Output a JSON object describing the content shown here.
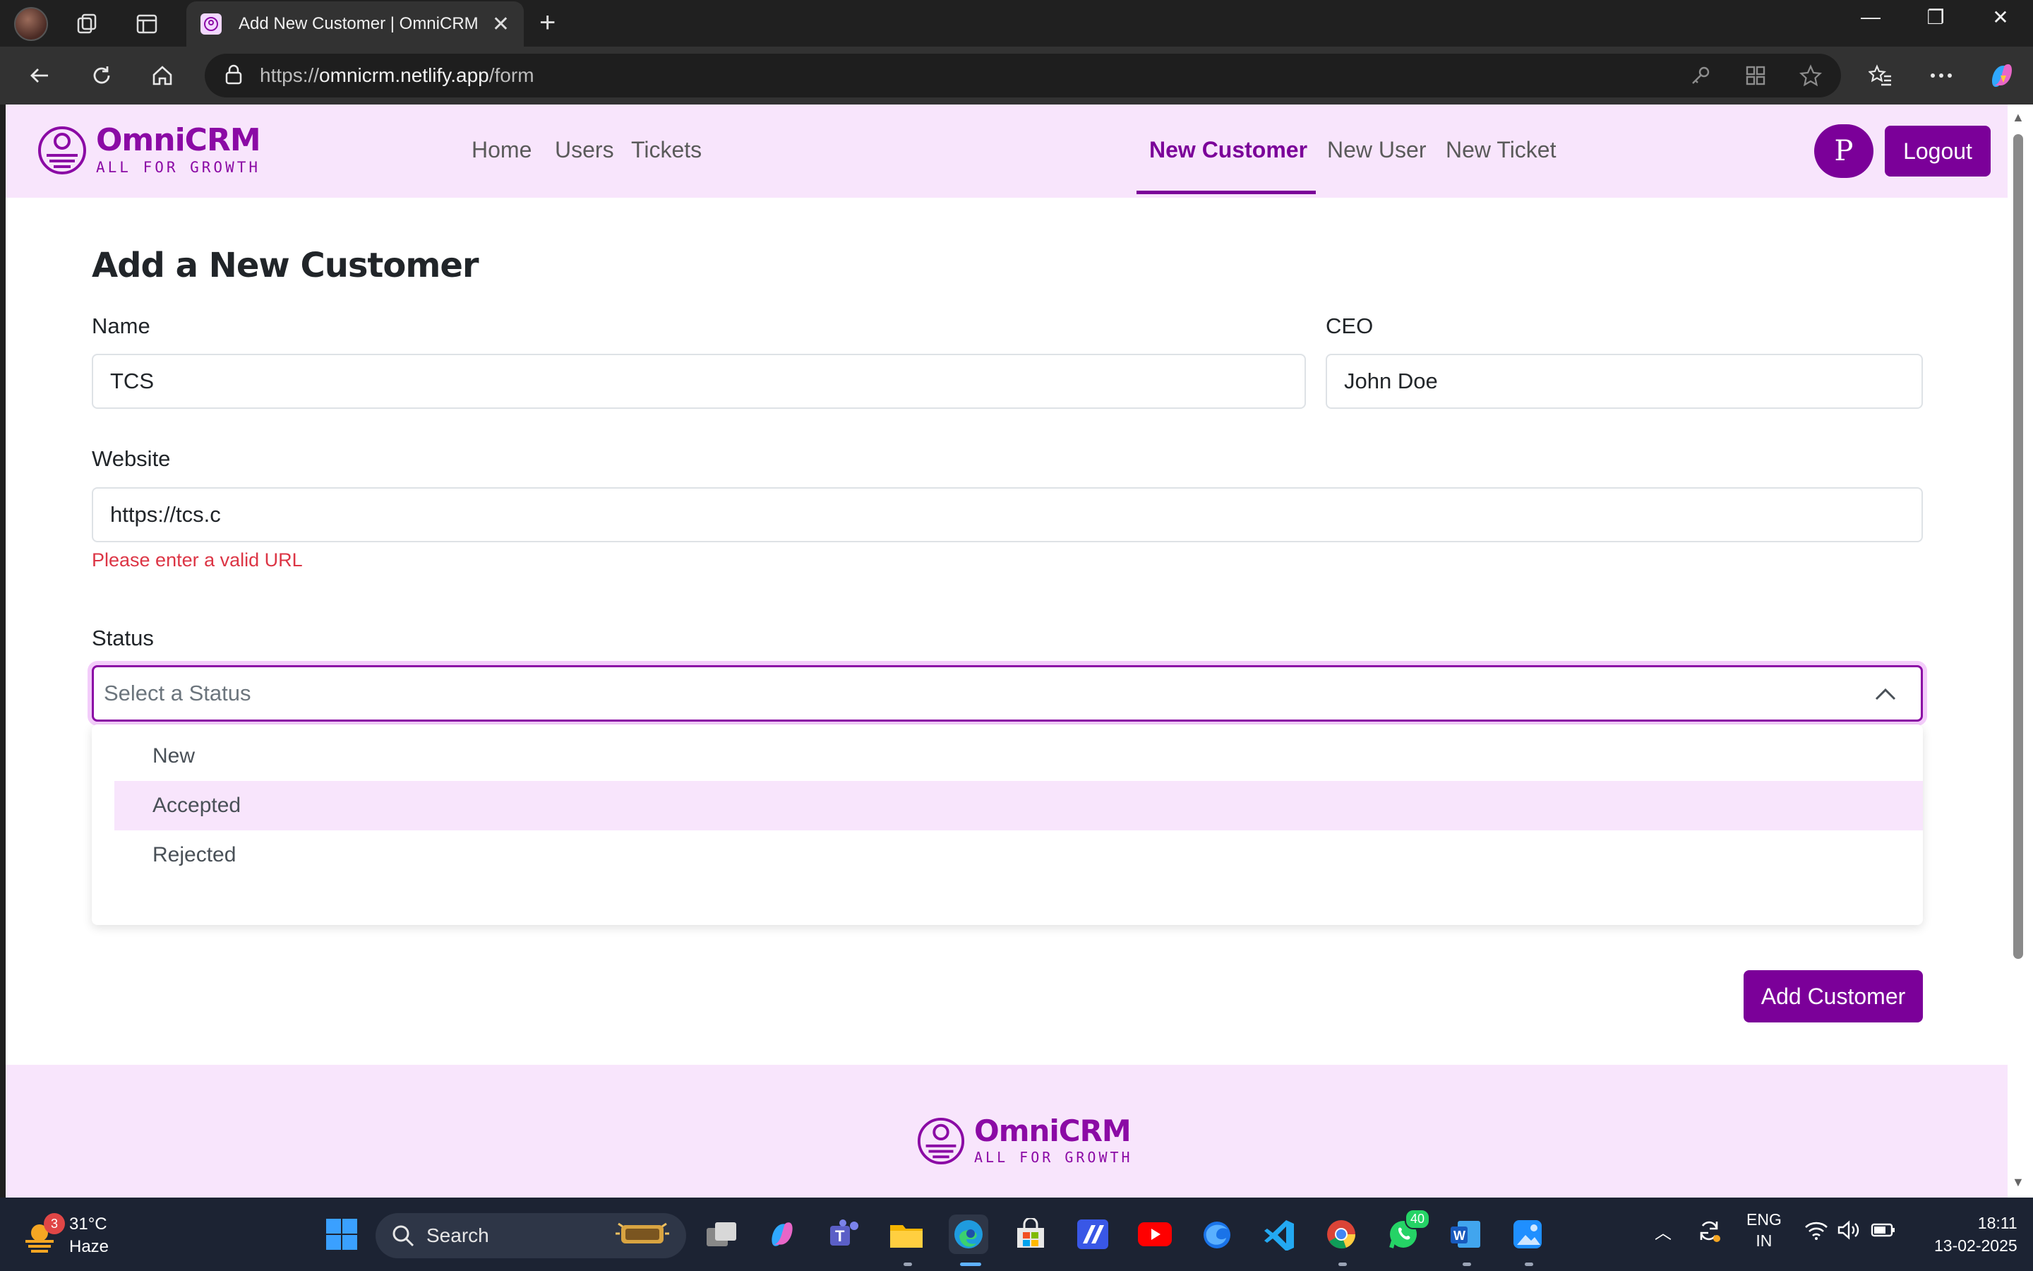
{
  "browser": {
    "tab_title": "Add New Customer | OmniCRM",
    "url_prefix": "https://",
    "url_host": "omnicrm.netlify.app",
    "url_path": "/form"
  },
  "header": {
    "logo_name": "OmniCRM",
    "logo_tagline": "ALL FOR GROWTH",
    "nav_left": [
      "Home",
      "Users",
      "Tickets"
    ],
    "nav_right": [
      "New Customer",
      "New User",
      "New Ticket"
    ],
    "active_nav": "New Customer",
    "avatar_initial": "P",
    "logout_label": "Logout"
  },
  "form": {
    "title": "Add a New Customer",
    "name_label": "Name",
    "name_value": "TCS",
    "ceo_label": "CEO",
    "ceo_value": "John Doe",
    "website_label": "Website",
    "website_value": "https://tcs.c",
    "website_error": "Please enter a valid URL",
    "status_label": "Status",
    "status_placeholder": "Select a Status",
    "status_options": [
      "New",
      "Accepted",
      "Rejected"
    ],
    "highlighted_option": "Accepted",
    "submit_label": "Add Customer"
  },
  "footer": {
    "logo_name": "OmniCRM",
    "logo_tagline": "ALL FOR GROWTH"
  },
  "taskbar": {
    "weather_badge": "3",
    "temperature": "31°C",
    "condition": "Haze",
    "search_label": "Search",
    "whatsapp_badge": "40",
    "language_line1": "ENG",
    "language_line2": "IN",
    "time": "18:11",
    "date": "13-02-2025"
  },
  "colors": {
    "brand": "#7b0099",
    "header_bg": "#f8e5fc",
    "error": "#dc3545"
  }
}
